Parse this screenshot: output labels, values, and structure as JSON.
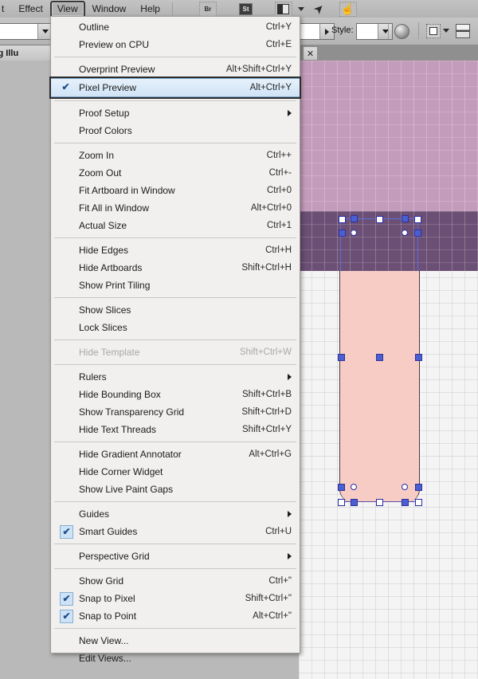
{
  "menubar": {
    "items": [
      {
        "label": "t",
        "active": false,
        "clipped": true
      },
      {
        "label": "Effect",
        "active": false
      },
      {
        "label": "View",
        "active": true
      },
      {
        "label": "Window",
        "active": false
      },
      {
        "label": "Help",
        "active": false
      }
    ],
    "icons": [
      {
        "name": "bridge-icon",
        "glyph": "Br"
      },
      {
        "name": "stock-icon",
        "glyph": "St"
      },
      {
        "name": "arrange-documents-icon",
        "glyph": ""
      },
      {
        "name": "rocket-icon",
        "glyph": "➤"
      },
      {
        "name": "hand-cursor-icon",
        "glyph": "☝"
      }
    ]
  },
  "controlbar": {
    "style_label": "Style:",
    "opacity_combo_value": "",
    "fill_swatch": "#ffffff",
    "style_swatch": "#ffffff"
  },
  "tabstrip": {
    "document_tab_label": "ns using Illu",
    "close_glyph": "✕"
  },
  "menu": {
    "sections": [
      {
        "items": [
          {
            "label": "Outline",
            "accel": "Ctrl+Y",
            "checked": false,
            "disabled": false,
            "submenu": false
          },
          {
            "label": "Preview on CPU",
            "accel": "Ctrl+E",
            "checked": false,
            "disabled": false,
            "submenu": false
          }
        ]
      },
      {
        "items": [
          {
            "label": "Overprint Preview",
            "accel": "Alt+Shift+Ctrl+Y",
            "checked": false,
            "disabled": false,
            "submenu": false
          },
          {
            "label": "Pixel Preview",
            "accel": "Alt+Ctrl+Y",
            "checked": true,
            "disabled": false,
            "submenu": false,
            "selected": true
          }
        ]
      },
      {
        "items": [
          {
            "label": "Proof Setup",
            "accel": "",
            "checked": false,
            "disabled": false,
            "submenu": true
          },
          {
            "label": "Proof Colors",
            "accel": "",
            "checked": false,
            "disabled": false,
            "submenu": false
          }
        ]
      },
      {
        "items": [
          {
            "label": "Zoom In",
            "accel": "Ctrl++",
            "checked": false,
            "disabled": false,
            "submenu": false
          },
          {
            "label": "Zoom Out",
            "accel": "Ctrl+-",
            "checked": false,
            "disabled": false,
            "submenu": false
          },
          {
            "label": "Fit Artboard in Window",
            "accel": "Ctrl+0",
            "checked": false,
            "disabled": false,
            "submenu": false
          },
          {
            "label": "Fit All in Window",
            "accel": "Alt+Ctrl+0",
            "checked": false,
            "disabled": false,
            "submenu": false
          },
          {
            "label": "Actual Size",
            "accel": "Ctrl+1",
            "checked": false,
            "disabled": false,
            "submenu": false
          }
        ]
      },
      {
        "items": [
          {
            "label": "Hide Edges",
            "accel": "Ctrl+H",
            "checked": false,
            "disabled": false,
            "submenu": false
          },
          {
            "label": "Hide Artboards",
            "accel": "Shift+Ctrl+H",
            "checked": false,
            "disabled": false,
            "submenu": false
          },
          {
            "label": "Show Print Tiling",
            "accel": "",
            "checked": false,
            "disabled": false,
            "submenu": false
          }
        ]
      },
      {
        "items": [
          {
            "label": "Show Slices",
            "accel": "",
            "checked": false,
            "disabled": false,
            "submenu": false
          },
          {
            "label": "Lock Slices",
            "accel": "",
            "checked": false,
            "disabled": false,
            "submenu": false
          }
        ]
      },
      {
        "items": [
          {
            "label": "Hide Template",
            "accel": "Shift+Ctrl+W",
            "checked": false,
            "disabled": true,
            "submenu": false
          }
        ]
      },
      {
        "items": [
          {
            "label": "Rulers",
            "accel": "",
            "checked": false,
            "disabled": false,
            "submenu": true
          },
          {
            "label": "Hide Bounding Box",
            "accel": "Shift+Ctrl+B",
            "checked": false,
            "disabled": false,
            "submenu": false
          },
          {
            "label": "Show Transparency Grid",
            "accel": "Shift+Ctrl+D",
            "checked": false,
            "disabled": false,
            "submenu": false
          },
          {
            "label": "Hide Text Threads",
            "accel": "Shift+Ctrl+Y",
            "checked": false,
            "disabled": false,
            "submenu": false
          }
        ]
      },
      {
        "items": [
          {
            "label": "Hide Gradient Annotator",
            "accel": "Alt+Ctrl+G",
            "checked": false,
            "disabled": false,
            "submenu": false
          },
          {
            "label": "Hide Corner Widget",
            "accel": "",
            "checked": false,
            "disabled": false,
            "submenu": false
          },
          {
            "label": "Show Live Paint Gaps",
            "accel": "",
            "checked": false,
            "disabled": false,
            "submenu": false
          }
        ]
      },
      {
        "items": [
          {
            "label": "Guides",
            "accel": "",
            "checked": false,
            "disabled": false,
            "submenu": true
          },
          {
            "label": "Smart Guides",
            "accel": "Ctrl+U",
            "checked": true,
            "disabled": false,
            "submenu": false
          }
        ]
      },
      {
        "items": [
          {
            "label": "Perspective Grid",
            "accel": "",
            "checked": false,
            "disabled": false,
            "submenu": true
          }
        ]
      },
      {
        "items": [
          {
            "label": "Show Grid",
            "accel": "Ctrl+\"",
            "checked": false,
            "disabled": false,
            "submenu": false
          },
          {
            "label": "Snap to Pixel",
            "accel": "Shift+Ctrl+\"",
            "checked": true,
            "disabled": false,
            "submenu": false
          },
          {
            "label": "Snap to Point",
            "accel": "Alt+Ctrl+\"",
            "checked": true,
            "disabled": false,
            "submenu": false
          }
        ]
      },
      {
        "items": [
          {
            "label": "New View...",
            "accel": "",
            "checked": false,
            "disabled": false,
            "submenu": false
          },
          {
            "label": "Edit Views...",
            "accel": "",
            "checked": false,
            "disabled": false,
            "submenu": false
          }
        ]
      }
    ],
    "check_glyph": "✔"
  },
  "canvas": {
    "colors": {
      "band_light": "#c49cbb",
      "band_dark": "#6b4f74",
      "shape_fill": "#f7ccc4",
      "selection": "#5b6fe0",
      "background": "#f4f4f4"
    }
  }
}
